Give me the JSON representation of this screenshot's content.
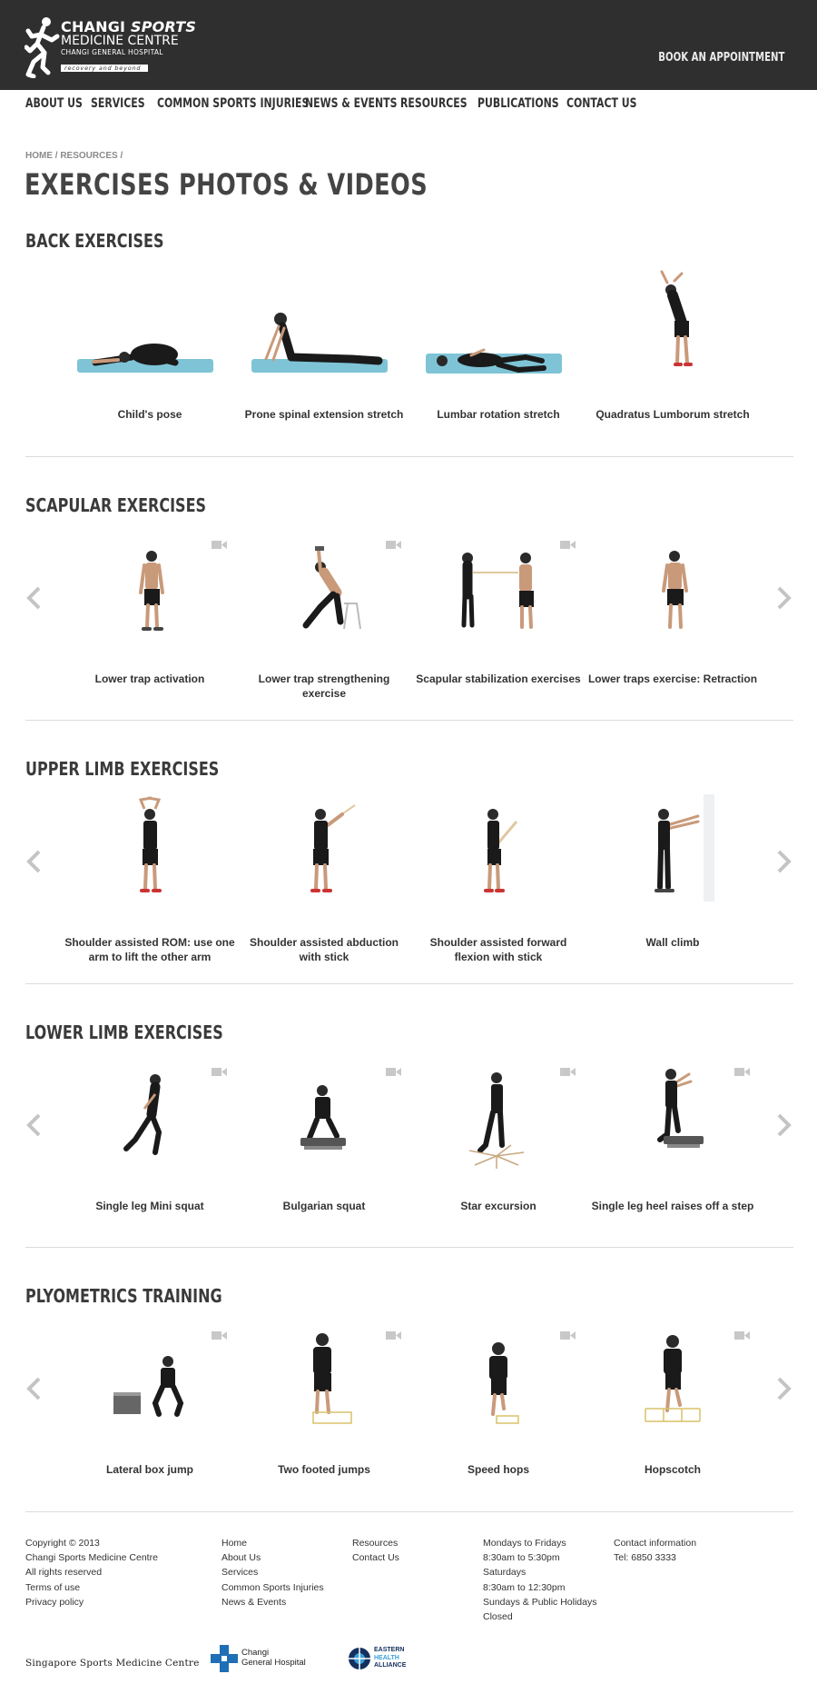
{
  "header": {
    "logo_line1_a": "CHANGI",
    "logo_line1_b": "SPORTS",
    "logo_line2": "MEDICINE CENTRE",
    "logo_line3": "CHANGI GENERAL HOSPITAL",
    "logo_tagline": "recovery and beyond",
    "book_label": "BOOK AN APPOINTMENT"
  },
  "nav": {
    "items": [
      {
        "label": "ABOUT US"
      },
      {
        "label": "SERVICES"
      },
      {
        "label": "COMMON SPORTS INJURIES"
      },
      {
        "label": "NEWS & EVENTS"
      },
      {
        "label": "RESOURCES"
      },
      {
        "label": "PUBLICATIONS"
      },
      {
        "label": "CONTACT US"
      }
    ]
  },
  "breadcrumb": "HOME / RESOURCES /",
  "page_title": "EXERCISES PHOTOS & VIDEOS",
  "sections": [
    {
      "title": "BACK EXERCISES",
      "items": [
        {
          "caption": "Child's pose"
        },
        {
          "caption": "Prone spinal extension stretch"
        },
        {
          "caption": "Lumbar rotation stretch"
        },
        {
          "caption": "Quadratus Lumborum stretch"
        }
      ]
    },
    {
      "title": "SCAPULAR EXERCISES",
      "items": [
        {
          "caption": "Lower trap activation"
        },
        {
          "caption": "Lower trap strengthening exercise"
        },
        {
          "caption": "Scapular stabilization exercises"
        },
        {
          "caption": "Lower traps exercise: Retraction"
        }
      ]
    },
    {
      "title": "UPPER LIMB EXERCISES",
      "items": [
        {
          "caption": "Shoulder assisted ROM: use one arm to lift the other arm"
        },
        {
          "caption": "Shoulder assisted abduction with stick"
        },
        {
          "caption": "Shoulder assisted forward flexion with stick"
        },
        {
          "caption": "Wall climb"
        }
      ]
    },
    {
      "title": "LOWER LIMB EXERCISES",
      "items": [
        {
          "caption": "Single leg Mini squat"
        },
        {
          "caption": "Bulgarian squat"
        },
        {
          "caption": "Star excursion"
        },
        {
          "caption": "Single leg heel raises off a step"
        }
      ]
    },
    {
      "title": "PLYOMETRICS TRAINING",
      "items": [
        {
          "caption": "Lateral box jump"
        },
        {
          "caption": "Two footed jumps"
        },
        {
          "caption": "Speed hops"
        },
        {
          "caption": "Hopscotch"
        }
      ]
    }
  ],
  "footer": {
    "col1": [
      "Copyright © 2013",
      "Changi Sports Medicine Centre",
      "All rights reserved",
      "Terms of use",
      "Privacy policy"
    ],
    "col2": [
      "Home",
      "About Us",
      "Services",
      "Common Sports Injuries",
      "News & Events"
    ],
    "col3": [
      "Resources",
      "Contact Us"
    ],
    "col4": [
      "Mondays to Fridays",
      "8:30am to 5:30pm",
      "Saturdays",
      "8:30am to 12:30pm",
      "Sundays & Public Holidays",
      "Closed"
    ],
    "col5": [
      "Contact information",
      "Tel: 6850 3333"
    ]
  },
  "partners": {
    "ssmc": "Singapore Sports Medicine Centre",
    "cgh_line1": "Changi",
    "cgh_line2": "General Hospital",
    "eha_line1": "EASTERN",
    "eha_line2": "HEALTH",
    "eha_line3": "ALLIANCE"
  },
  "colors": {
    "header_bg": "#2f2f2f",
    "mat_blue": "#7ec4d6",
    "cgh_blue": "#1e6fb5",
    "arrow_grey": "#c4c4c4",
    "camera_grey": "#c8c8c8"
  },
  "icons": [
    "runner-logo-icon",
    "camera-icon",
    "chevron-left-icon",
    "chevron-right-icon"
  ]
}
